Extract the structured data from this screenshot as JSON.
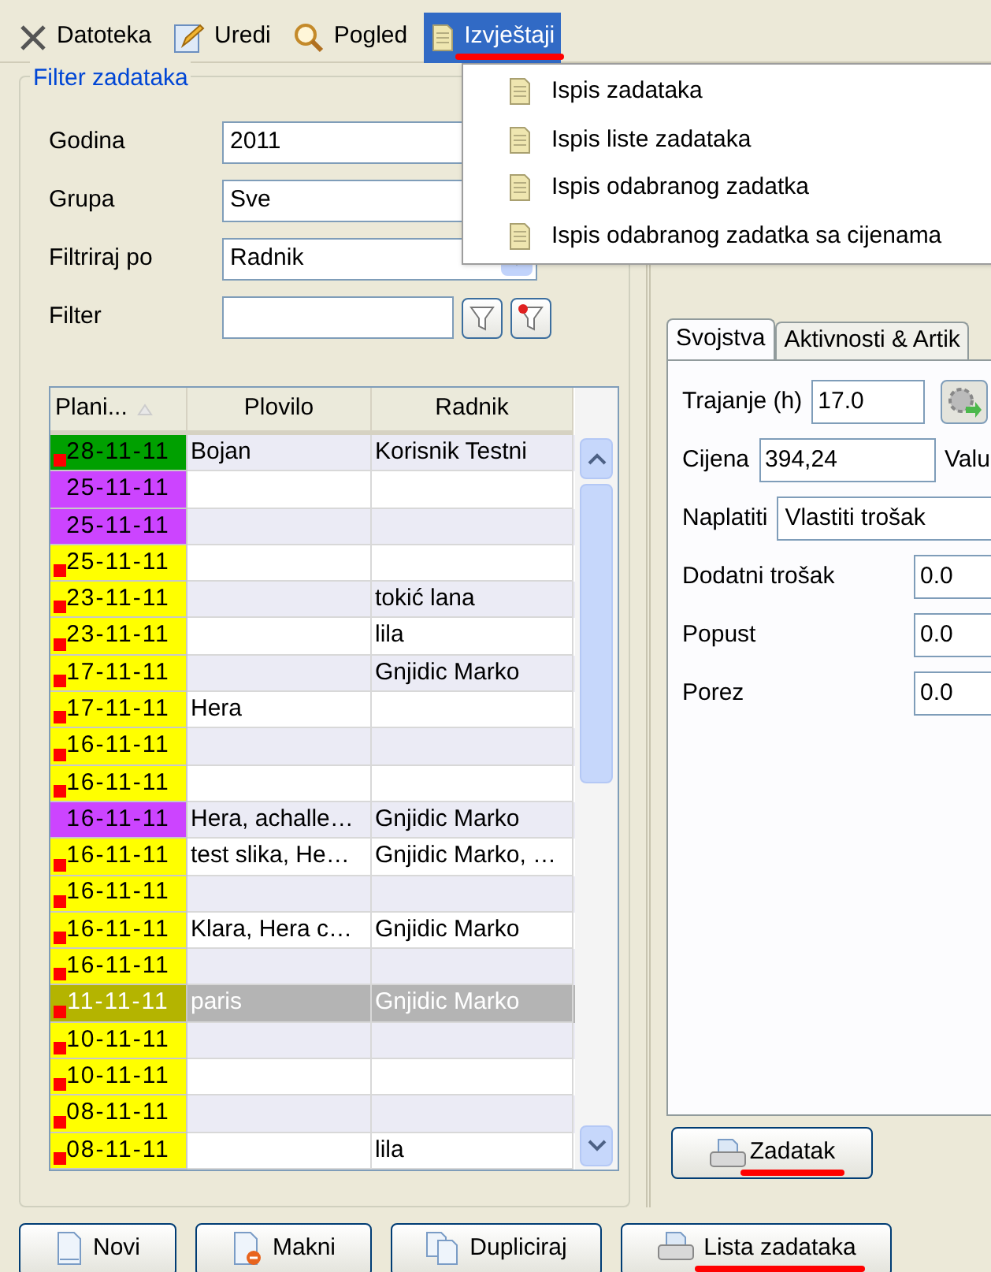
{
  "menu_bar": [
    {
      "label": "Datoteka",
      "selected": false,
      "underlined": false
    },
    {
      "label": "Uredi",
      "selected": false,
      "underlined": false
    },
    {
      "label": "Pogled",
      "selected": false,
      "underlined": false
    },
    {
      "label": "Izvještaji",
      "selected": true,
      "underlined": true
    }
  ],
  "dropdown": [
    "Ispis zadataka",
    "Ispis liste zadataka",
    "Ispis odabranog zadatka",
    "Ispis odabranog zadatka sa cijenama"
  ],
  "filter": {
    "title": "Filter zadataka",
    "fields": [
      {
        "label": "Godina",
        "value": "2011",
        "kind": "combo"
      },
      {
        "label": "Grupa",
        "value": "Sve",
        "kind": "combo"
      },
      {
        "label": "Filtriraj po",
        "value": "Radnik",
        "kind": "combo"
      },
      {
        "label": "Filter",
        "kind": "text"
      }
    ]
  },
  "table": {
    "columns": [
      "Plani...",
      "Plovilo",
      "Radnik"
    ],
    "rows": [
      {
        "date": "28-11-11",
        "color": "#00a000",
        "flag": true,
        "plovilo": "Bojan",
        "radnik": "Korisnik Testni",
        "selected": false
      },
      {
        "date": "25-11-11",
        "color": "#cc44ff",
        "flag": false,
        "selected": false
      },
      {
        "date": "25-11-11",
        "color": "#cc44ff",
        "flag": false,
        "selected": false
      },
      {
        "date": "25-11-11",
        "color": "#ffff00",
        "flag": true,
        "selected": false
      },
      {
        "date": "23-11-11",
        "color": "#ffff00",
        "flag": true,
        "radnik": "tokić lana",
        "selected": false
      },
      {
        "date": "23-11-11",
        "color": "#ffff00",
        "flag": true,
        "radnik": "lila",
        "selected": false
      },
      {
        "date": "17-11-11",
        "color": "#ffff00",
        "flag": true,
        "radnik": "Gnjidic Marko",
        "selected": false
      },
      {
        "date": "17-11-11",
        "color": "#ffff00",
        "flag": true,
        "plovilo": "Hera",
        "selected": false
      },
      {
        "date": "16-11-11",
        "color": "#ffff00",
        "flag": true,
        "selected": false
      },
      {
        "date": "16-11-11",
        "color": "#ffff00",
        "flag": true,
        "selected": false
      },
      {
        "date": "16-11-11",
        "color": "#cc44ff",
        "flag": false,
        "plovilo": "Hera, achalle…",
        "radnik": "Gnjidic Marko",
        "selected": false
      },
      {
        "date": "16-11-11",
        "color": "#ffff00",
        "flag": true,
        "plovilo": "test slika, He…",
        "radnik": "Gnjidic Marko, …",
        "selected": false
      },
      {
        "date": "16-11-11",
        "color": "#ffff00",
        "flag": true,
        "selected": false
      },
      {
        "date": "16-11-11",
        "color": "#ffff00",
        "flag": true,
        "plovilo": "Klara, Hera c…",
        "radnik": "Gnjidic Marko",
        "selected": false
      },
      {
        "date": "16-11-11",
        "color": "#ffff00",
        "flag": true,
        "selected": false
      },
      {
        "date": "11-11-11",
        "color": "#b4b400",
        "flag": true,
        "plovilo": "paris",
        "radnik": "Gnjidic Marko",
        "selected": true
      },
      {
        "date": "10-11-11",
        "color": "#ffff00",
        "flag": true,
        "selected": false
      },
      {
        "date": "10-11-11",
        "color": "#ffff00",
        "flag": true,
        "selected": false
      },
      {
        "date": "08-11-11",
        "color": "#ffff00",
        "flag": true,
        "selected": false
      },
      {
        "date": "08-11-11",
        "color": "#ffff00",
        "flag": true,
        "radnik": "lila",
        "selected": false
      }
    ]
  },
  "detail_tabs": [
    {
      "label": "Svojstva",
      "selected": true
    },
    {
      "label": "Aktivnosti & Artik",
      "selected": false
    }
  ],
  "properties": [
    {
      "label": "Trajanje (h)",
      "value": "17.0",
      "kind": "action"
    },
    {
      "label": "Cijena",
      "value": "394,24",
      "kind": "suffix",
      "suffix": "Valu"
    },
    {
      "label": "Naplatiti",
      "value": "Vlastiti trošak",
      "kind": "wide"
    },
    {
      "label": "Dodatni trošak",
      "value": "0.0",
      "kind": "number"
    },
    {
      "label": "Popust",
      "value": "0.0",
      "kind": "number"
    },
    {
      "label": "Porez",
      "value": "0.0",
      "kind": "number"
    }
  ],
  "task_button": {
    "label": "Zadatak",
    "underlined": true
  },
  "bottom_buttons": [
    {
      "label": "Novi",
      "underlined": false
    },
    {
      "label": "Makni",
      "underlined": false
    },
    {
      "label": "Dupliciraj",
      "underlined": false
    },
    {
      "label": "Lista zadataka",
      "underlined": true
    }
  ]
}
